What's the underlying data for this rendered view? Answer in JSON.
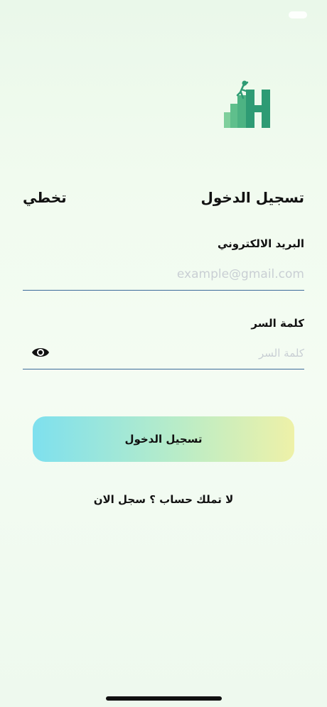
{
  "header": {
    "title": "تسجيل الدخول",
    "skip_label": "تخطي"
  },
  "form": {
    "email_label": "البريد الالكتروني",
    "email_placeholder": "example@gmail.com",
    "email_value": "",
    "password_label": "كلمة السر",
    "password_placeholder": "كلمة السر",
    "password_value": "",
    "show_password_icon": "eye-icon"
  },
  "actions": {
    "login_button": "تسجيل الدخول",
    "register_prompt": "لا تملك حساب ؟ سجل الان"
  },
  "colors": {
    "logo_dark": "#2e9b74",
    "logo_light": "#7fcf9c",
    "field_underline": "#3c6b9a",
    "button_gradient_start": "#7ee0ee",
    "button_gradient_end": "#eef1a8"
  }
}
